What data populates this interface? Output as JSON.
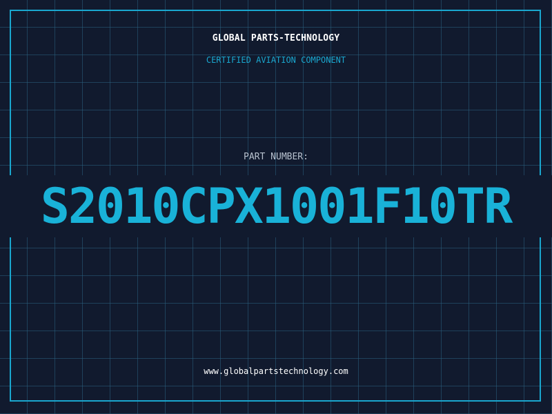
{
  "header": {
    "company": "GLOBAL PARTS-TECHNOLOGY",
    "tagline": "CERTIFIED AVIATION COMPONENT"
  },
  "part": {
    "label": "PART NUMBER:",
    "number": "S2010CPX1001F10TR"
  },
  "footer": {
    "website": "www.globalpartstechnology.com"
  },
  "colors": {
    "background": "#111a2e",
    "grid": "#2a6080",
    "accent": "#1aa7cf",
    "text": "#ffffff",
    "label": "#b8c2cf"
  }
}
